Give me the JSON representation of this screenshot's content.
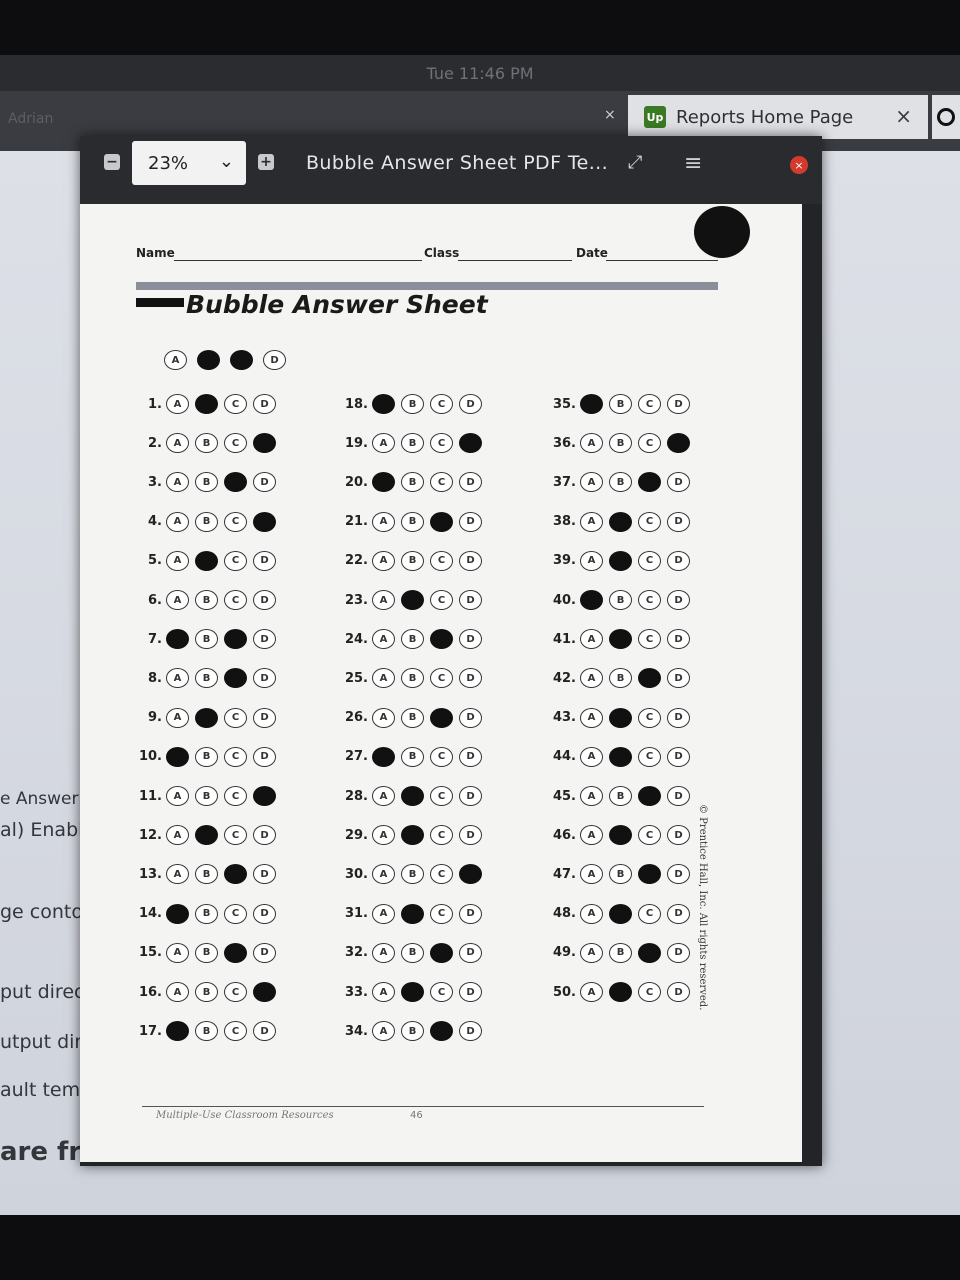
{
  "system": {
    "clock": "Tue 11:46 PM"
  },
  "browser": {
    "ghost_tab": "Adrian",
    "tab_title": "Reports Home Page",
    "tab_logo": "Up",
    "tab_close": "×"
  },
  "background_page": {
    "fragments": [
      "e Answer",
      "al) Enable",
      "ge contol",
      "put directo",
      "utput dire",
      "ault templ",
      "are fre"
    ]
  },
  "viewer": {
    "zoom": "23%",
    "title": "Bubble Answer Sheet PDF Te...",
    "icons": {
      "zoom_out": "minus-icon",
      "zoom_in": "plus-icon",
      "expand": "expand-icon",
      "menu": "menu-icon",
      "close": "close-icon"
    }
  },
  "sheet": {
    "name_label": "Name",
    "class_label": "Class",
    "date_label": "Date",
    "title": "Bubble Answer Sheet",
    "options": [
      "A",
      "B",
      "C",
      "D"
    ],
    "example_filled": [
      1,
      2
    ],
    "questions": [
      {
        "num": "1.",
        "filled": [
          1
        ]
      },
      {
        "num": "2.",
        "filled": [
          3
        ]
      },
      {
        "num": "3.",
        "filled": [
          2
        ]
      },
      {
        "num": "4.",
        "filled": [
          3
        ]
      },
      {
        "num": "5.",
        "filled": [
          1
        ]
      },
      {
        "num": "6.",
        "filled": []
      },
      {
        "num": "7.",
        "filled": [
          0,
          2
        ]
      },
      {
        "num": "8.",
        "filled": [
          2
        ]
      },
      {
        "num": "9.",
        "filled": [
          1
        ]
      },
      {
        "num": "10.",
        "filled": [
          0
        ]
      },
      {
        "num": "11.",
        "filled": [
          3
        ]
      },
      {
        "num": "12.",
        "filled": [
          1
        ]
      },
      {
        "num": "13.",
        "filled": [
          2
        ]
      },
      {
        "num": "14.",
        "filled": [
          0
        ]
      },
      {
        "num": "15.",
        "filled": [
          2
        ]
      },
      {
        "num": "16.",
        "filled": [
          3
        ]
      },
      {
        "num": "17.",
        "filled": [
          0
        ]
      },
      {
        "num": "18.",
        "filled": [
          0
        ]
      },
      {
        "num": "19.",
        "filled": [
          3
        ]
      },
      {
        "num": "20.",
        "filled": [
          0
        ]
      },
      {
        "num": "21.",
        "filled": [
          2
        ]
      },
      {
        "num": "22.",
        "filled": []
      },
      {
        "num": "23.",
        "filled": [
          1
        ]
      },
      {
        "num": "24.",
        "filled": [
          2
        ]
      },
      {
        "num": "25.",
        "filled": []
      },
      {
        "num": "26.",
        "filled": [
          2
        ]
      },
      {
        "num": "27.",
        "filled": [
          0
        ]
      },
      {
        "num": "28.",
        "filled": [
          1
        ]
      },
      {
        "num": "29.",
        "filled": [
          1
        ]
      },
      {
        "num": "30.",
        "filled": [
          3
        ]
      },
      {
        "num": "31.",
        "filled": [
          1
        ]
      },
      {
        "num": "32.",
        "filled": [
          2
        ]
      },
      {
        "num": "33.",
        "filled": [
          1
        ]
      },
      {
        "num": "34.",
        "filled": [
          2
        ]
      },
      {
        "num": "35.",
        "filled": [
          0
        ]
      },
      {
        "num": "36.",
        "filled": [
          3
        ]
      },
      {
        "num": "37.",
        "filled": [
          2
        ]
      },
      {
        "num": "38.",
        "filled": [
          1
        ]
      },
      {
        "num": "39.",
        "filled": [
          1
        ]
      },
      {
        "num": "40.",
        "filled": [
          0
        ]
      },
      {
        "num": "41.",
        "filled": [
          1
        ]
      },
      {
        "num": "42.",
        "filled": [
          2
        ]
      },
      {
        "num": "43.",
        "filled": [
          1
        ]
      },
      {
        "num": "44.",
        "filled": [
          1
        ]
      },
      {
        "num": "45.",
        "filled": [
          2
        ]
      },
      {
        "num": "46.",
        "filled": [
          1
        ]
      },
      {
        "num": "47.",
        "filled": [
          2
        ]
      },
      {
        "num": "48.",
        "filled": [
          1
        ]
      },
      {
        "num": "49.",
        "filled": [
          2
        ]
      },
      {
        "num": "50.",
        "filled": [
          1
        ]
      }
    ],
    "copyright": "© Prentice Hall, Inc. All rights reserved.",
    "footer_text": "Multiple-Use Classroom Resources",
    "footer_page": "46"
  }
}
